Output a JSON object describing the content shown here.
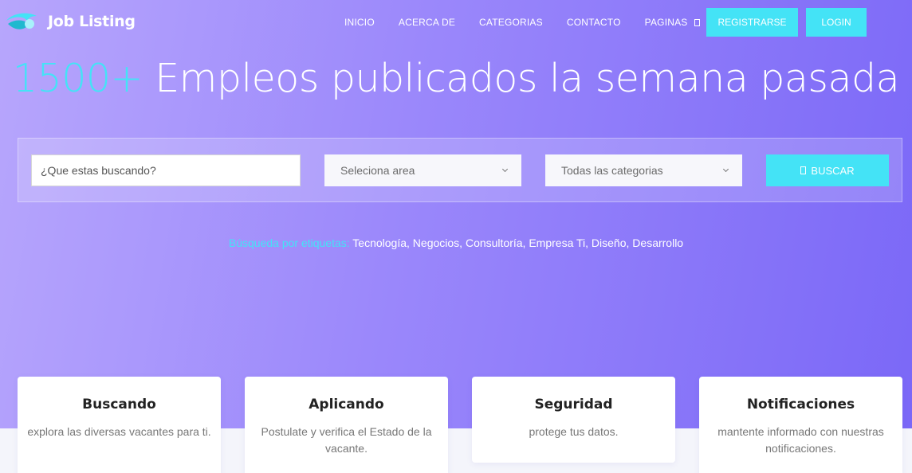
{
  "brand": {
    "name": "Job Listing",
    "accent": "#44e3f6",
    "gradient_start": "#b7a6fc",
    "gradient_end": "#7b68f7"
  },
  "nav": {
    "items": [
      "INICIO",
      "ACERCA DE",
      "CATEGORIAS",
      "CONTACTO",
      "PAGINAS"
    ],
    "register_label": "REGISTRARSE",
    "login_label": "LOGIN"
  },
  "hero": {
    "count": "1500+",
    "headline": "Empleos publicados la semana pasada"
  },
  "search": {
    "placeholder": "¿Que estas buscando?",
    "area_selected": "Seleciona area",
    "category_selected": "Todas las categorias",
    "button_label": "BUSCAR"
  },
  "tags": {
    "label": "Búsqueda por etiquetas:",
    "items": [
      "Tecnología",
      "Negocios",
      "Consultoría",
      "Empresa Ti",
      "Diseño",
      "Desarrollo"
    ]
  },
  "features": [
    {
      "title": "Buscando",
      "text": "explora las diversas vacantes para ti."
    },
    {
      "title": "Aplicando",
      "text": "Postulate y verifica el Estado de la vacante."
    },
    {
      "title": "Seguridad",
      "text": "protege tus datos."
    },
    {
      "title": "Notificaciones",
      "text": "mantente informado con nuestras notificaciones."
    }
  ]
}
